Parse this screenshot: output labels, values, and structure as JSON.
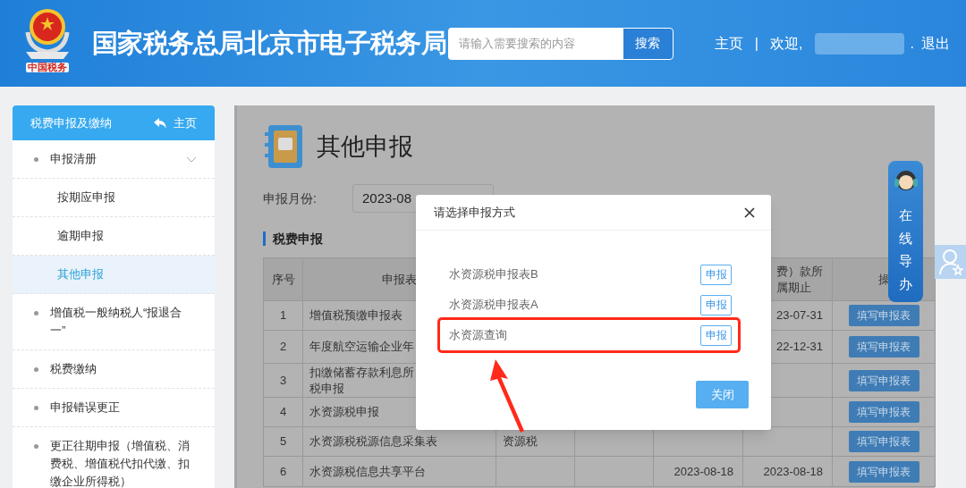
{
  "header": {
    "logo_text": "中国税务",
    "site_title": "国家税务总局北京市电子税务局",
    "search": {
      "placeholder": "请输入需要搜索的内容",
      "button": "搜索"
    },
    "nav": {
      "home": "主页",
      "separator": "|",
      "greeting": "欢迎,",
      "name_suffix": ".",
      "logout": "退出"
    }
  },
  "sidebar": {
    "title": "税费申报及缴纳",
    "home_link": "主页",
    "items": [
      {
        "label": "申报清册",
        "expanded": true,
        "selected": false,
        "children": [
          {
            "label": "按期应申报",
            "selected": false
          },
          {
            "label": "逾期申报",
            "selected": false
          },
          {
            "label": "其他申报",
            "selected": true
          }
        ]
      },
      {
        "label": "增值税一般纳税人“报退合一”",
        "selected": false
      },
      {
        "label": "税费缴纳",
        "selected": false
      },
      {
        "label": "申报错误更正",
        "selected": false
      },
      {
        "label": "更正往期申报（增值税、消费税、增值税代扣代缴、扣缴企业所得税）",
        "selected": false
      }
    ]
  },
  "main": {
    "title": "其他申报",
    "month_label": "申报月份:",
    "month_value": "2023-08",
    "section_title": "税费申报",
    "table": {
      "columns": [
        {
          "label": "序号"
        },
        {
          "label": "申报表"
        },
        {},
        {},
        {},
        {
          "label": "费）款所属期止"
        },
        {
          "label": "操"
        }
      ],
      "rows": [
        {
          "cells": [
            "1",
            "增值税预缴申报表",
            null,
            null,
            null,
            "23-07-31"
          ],
          "action": "填写申报表"
        },
        {
          "cells": [
            "2",
            "年度航空运输企业年",
            null,
            null,
            null,
            "22-12-31"
          ],
          "action": "填写申报表"
        },
        {
          "cells": [
            "3",
            [
              "扣缴储蓄存款利息所",
              "税申报"
            ],
            null,
            null,
            null,
            null
          ],
          "action": "填写申报表"
        },
        {
          "cells": [
            "4",
            "水资源税申报",
            null,
            null,
            null,
            null
          ],
          "action": "填写申报表"
        },
        {
          "cells": [
            "5",
            "水资源税税源信息采集表",
            "资源税",
            null,
            null,
            null
          ],
          "action": "填写申报表"
        },
        {
          "cells": [
            "6",
            "水资源税信息共享平台",
            null,
            null,
            "2023-08-18",
            "2023-08-18"
          ],
          "action": "填写申报表"
        }
      ]
    }
  },
  "dialog": {
    "title": "请选择申报方式",
    "items": [
      {
        "label": "水资源税申报表B",
        "button": "申报",
        "highlighted": false
      },
      {
        "label": "水资源税申报表A",
        "button": "申报",
        "highlighted": false
      },
      {
        "label": "水资源查询",
        "button": "申报",
        "highlighted": true
      }
    ],
    "close_button": "关闭"
  },
  "guide_widget": {
    "label": "在线导办"
  }
}
